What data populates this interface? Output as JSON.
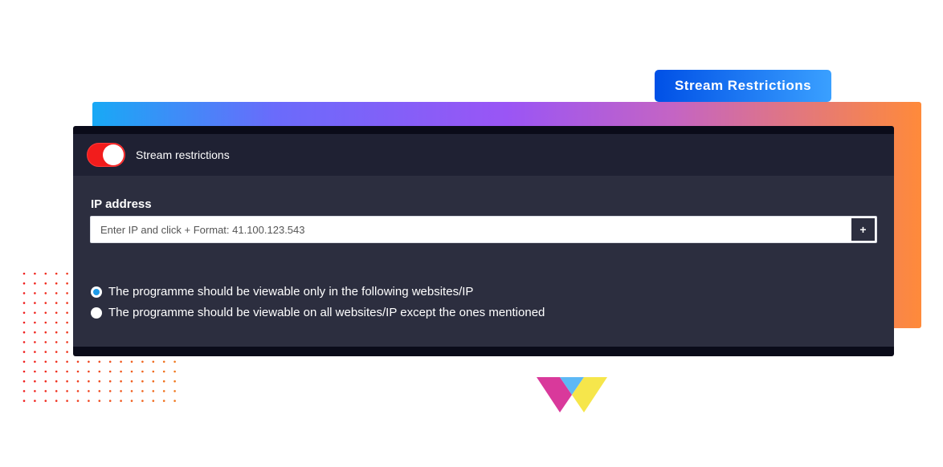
{
  "badge": {
    "title": "Stream Restrictions"
  },
  "panel": {
    "toggle": {
      "label": "Stream restrictions",
      "on": true
    },
    "ip": {
      "label": "IP address",
      "placeholder": "Enter IP and click + Format: 41.100.123.543",
      "value": "",
      "add_label": "+"
    },
    "options": [
      {
        "label": "The programme should be viewable only in the following websites/IP",
        "selected": true
      },
      {
        "label": "The programme should be viewable on all websites/IP except the ones mentioned",
        "selected": false
      }
    ]
  },
  "colors": {
    "toggle_on": "#f21c1c",
    "radio_selected": "#1e9ae8",
    "panel_bg": "#2c2e3f",
    "header_bg": "#1f2133"
  }
}
